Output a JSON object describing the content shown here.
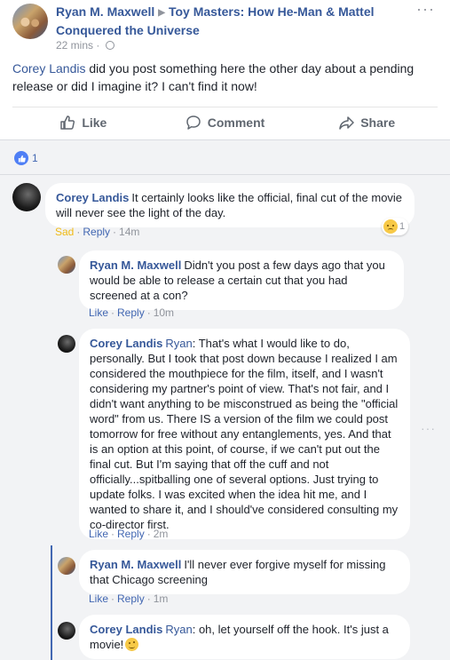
{
  "post": {
    "author": "Ryan M. Maxwell",
    "group": "Toy Masters: How He-Man & Mattel Conquered the Universe",
    "time": "22 mins",
    "mention": "Corey Landis",
    "text": " did you post something here the other day about a pending release or did I imagine it? I can't find it now!",
    "menu_glyph": "···"
  },
  "actions": {
    "like": "Like",
    "comment": "Comment",
    "share": "Share"
  },
  "reactions": {
    "like_count": "1",
    "icon": "thumbs-up-icon",
    "color": "#4f7ff5"
  },
  "comments": [
    {
      "author": "Corey Landis",
      "text": "It certainly looks like the official, final cut of the movie will never see the light of the day.",
      "reaction_label": "Sad",
      "reply": "Reply",
      "time": "14m",
      "emoji_count": "1"
    },
    {
      "author": "Ryan M. Maxwell",
      "text": "Didn't you post a few days ago that you would be able to release a certain cut that you had screened at a con?",
      "like": "Like",
      "reply": "Reply",
      "time": "10m"
    },
    {
      "author": "Corey Landis",
      "mention": "Ryan",
      "text": ": That's what I would like to do, personally. But I took that post down because I realized I am considered the mouthpiece for the film, itself, and I wasn't considering my partner's point of view. That's not fair, and I didn't want anything to be misconstrued as being the \"official word\" from us. There IS a version of the film we could post tomorrow for free without any entanglements, yes. And that is an option at this point, of course, if we can't put out the final cut. But I'm saying that off the cuff and not officially...spitballing one of several options. Just trying to update folks. I was excited when the idea hit me, and I wanted to share it, and I should've considered consulting my co-director first.",
      "like": "Like",
      "reply": "Reply",
      "time": "2m"
    },
    {
      "author": "Ryan M. Maxwell",
      "text": "I'll never ever forgive myself for missing that Chicago screening",
      "like": "Like",
      "reply": "Reply",
      "time": "1m"
    },
    {
      "author": "Corey Landis",
      "mention": "Ryan",
      "text": ": oh, let yourself off the hook. It's just a movie!"
    }
  ],
  "colors": {
    "link": "#365899",
    "meta": "#90949c",
    "background": "#f2f3f5",
    "sad": "#f0ba15",
    "thread": "#4267b2"
  }
}
